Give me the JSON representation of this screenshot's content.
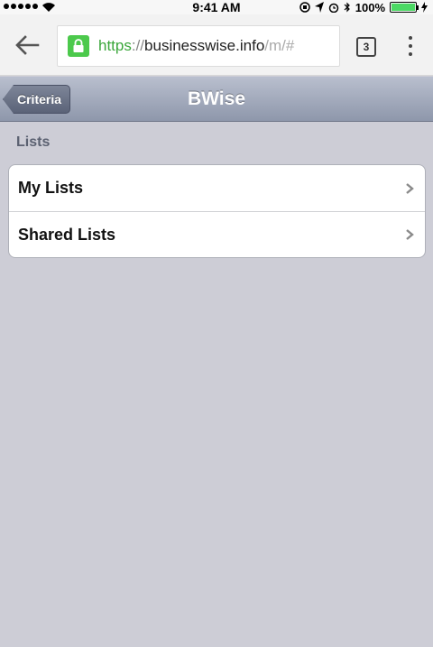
{
  "status_bar": {
    "time": "9:41 AM",
    "battery": "100%",
    "battery_level": 1.0
  },
  "browser": {
    "url_scheme": "https",
    "url_sep": "://",
    "url_host": "businesswise.info",
    "url_path": "/m/#",
    "tab_count": "3"
  },
  "nav": {
    "back_label": "Criteria",
    "title": "BWise"
  },
  "section": {
    "header": "Lists",
    "items": [
      {
        "label": "My Lists"
      },
      {
        "label": "Shared Lists"
      }
    ]
  },
  "colors": {
    "background": "#cdcdd6",
    "nav_bar": "#9aa2b5",
    "secure": "#4cc94c"
  }
}
